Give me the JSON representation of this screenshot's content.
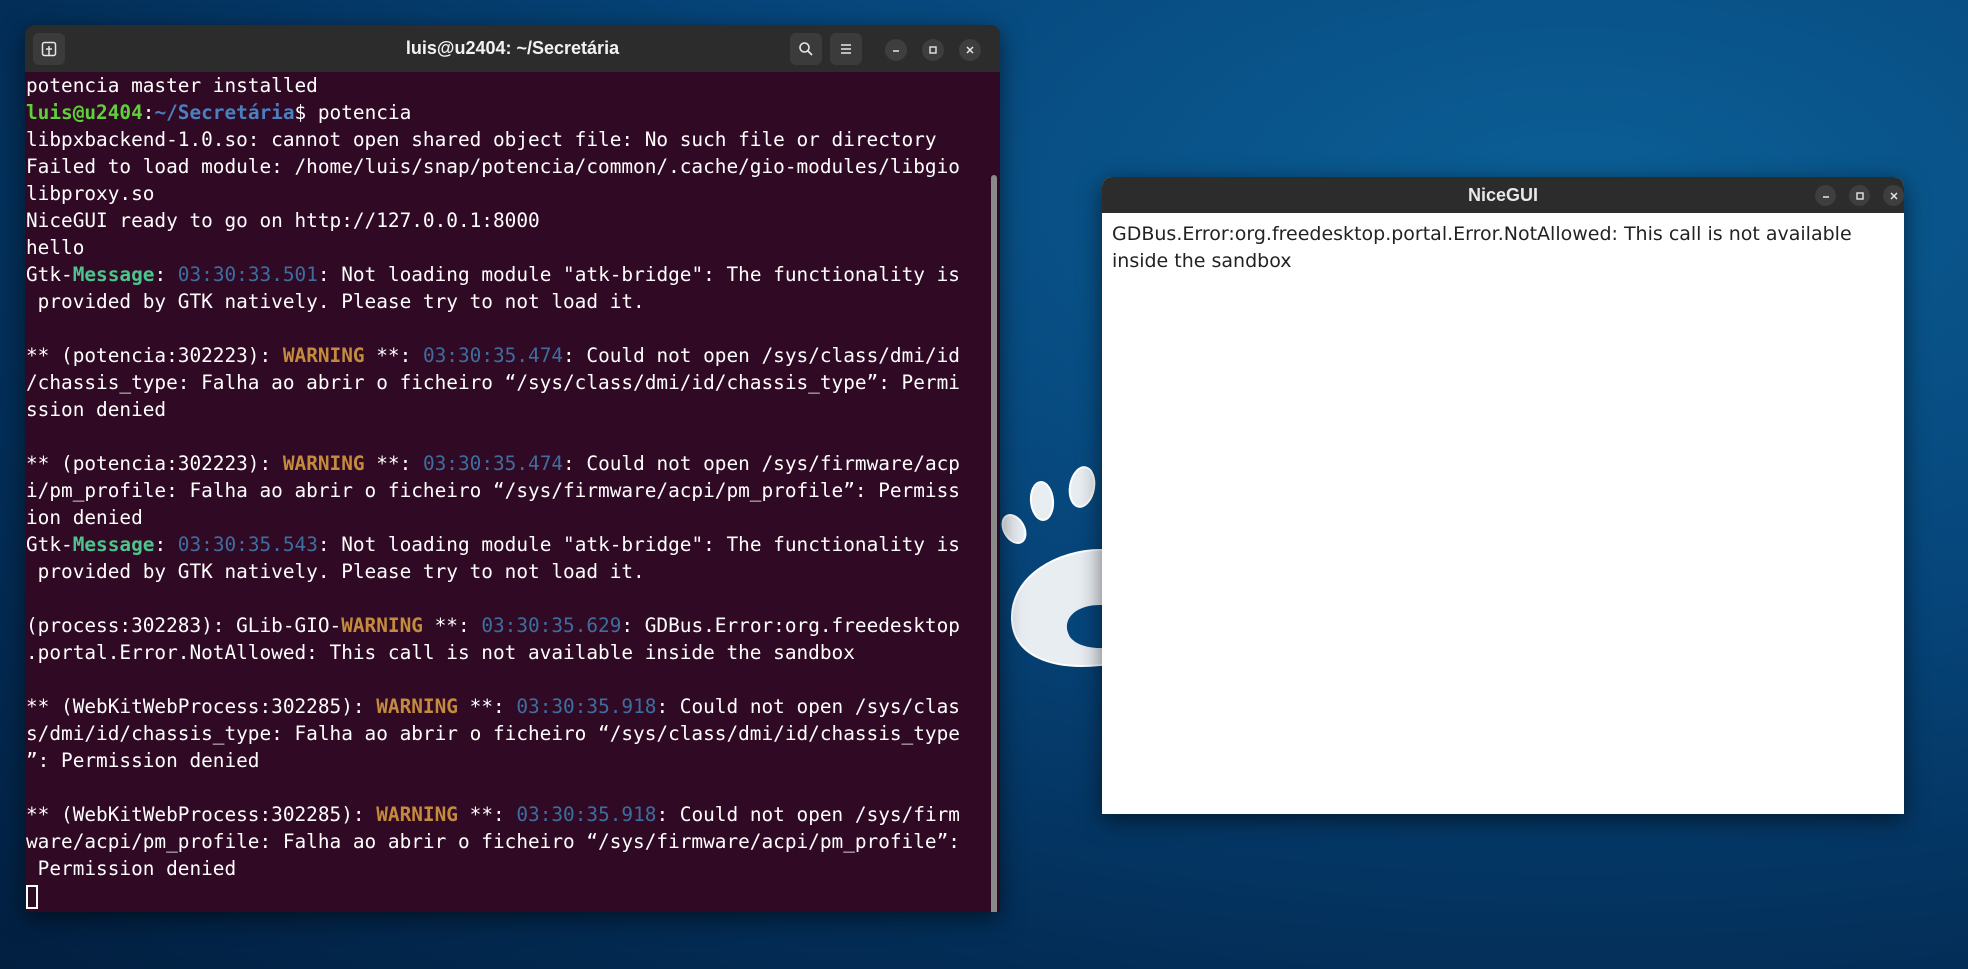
{
  "terminal": {
    "title": "luis@u2404: ~/Secretária",
    "prompt_user": "luis@u2404",
    "prompt_path": "~/Secretária",
    "command": "potencia"
  },
  "nicegui": {
    "title": "NiceGUI",
    "message": "GDBus.Error:org.freedesktop.portal.Error.NotAllowed: This call is not available inside the sandbox"
  },
  "colors": {
    "terminal_bg": "#300a24",
    "titlebar_bg": "#2c2c2c",
    "prompt_user": "#5ed13a",
    "prompt_path": "#4a7fc0",
    "warning": "#c48b3e",
    "message": "#4cc48c",
    "timestamp": "#3d6ea0"
  },
  "icons": {
    "new_tab": "new-tab-icon",
    "search": "search-icon",
    "menu": "hamburger-menu-icon",
    "minimize": "minimize-icon",
    "maximize": "maximize-icon",
    "close": "close-icon"
  },
  "lines": [
    [
      {
        "t": "potencia master installed"
      }
    ],
    [
      {
        "t": "luis@u2404",
        "c": "u"
      },
      {
        "t": ":"
      },
      {
        "t": "~/Secretária",
        "c": "p"
      },
      {
        "t": "$ potencia"
      }
    ],
    [
      {
        "t": "libpxbackend-1.0.so: cannot open shared object file: No such file or directory"
      }
    ],
    [
      {
        "t": "Failed to load module: /home/luis/snap/potencia/common/.cache/gio-modules/libgio"
      }
    ],
    [
      {
        "t": "libproxy.so"
      }
    ],
    [
      {
        "t": "NiceGUI ready to go on http://127.0.0.1:8000"
      }
    ],
    [
      {
        "t": "hello"
      }
    ],
    [
      {
        "t": "Gtk-"
      },
      {
        "t": "Message",
        "c": "g"
      },
      {
        "t": ": "
      },
      {
        "t": "03:30:33.501",
        "c": "ts"
      },
      {
        "t": ": Not loading module \"atk-bridge\": The functionality is"
      }
    ],
    [
      {
        "t": " provided by GTK natively. Please try to not load it."
      }
    ],
    [],
    [
      {
        "t": "** (potencia:302223): "
      },
      {
        "t": "WARNING",
        "c": "w"
      },
      {
        "t": " **: "
      },
      {
        "t": "03:30:35.474",
        "c": "ts"
      },
      {
        "t": ": Could not open /sys/class/dmi/id"
      }
    ],
    [
      {
        "t": "/chassis_type: Falha ao abrir o ficheiro “/sys/class/dmi/id/chassis_type”: Permi"
      }
    ],
    [
      {
        "t": "ssion denied"
      }
    ],
    [],
    [
      {
        "t": "** (potencia:302223): "
      },
      {
        "t": "WARNING",
        "c": "w"
      },
      {
        "t": " **: "
      },
      {
        "t": "03:30:35.474",
        "c": "ts"
      },
      {
        "t": ": Could not open /sys/firmware/acp"
      }
    ],
    [
      {
        "t": "i/pm_profile: Falha ao abrir o ficheiro “/sys/firmware/acpi/pm_profile”: Permiss"
      }
    ],
    [
      {
        "t": "ion denied"
      }
    ],
    [
      {
        "t": "Gtk-"
      },
      {
        "t": "Message",
        "c": "g"
      },
      {
        "t": ": "
      },
      {
        "t": "03:30:35.543",
        "c": "ts"
      },
      {
        "t": ": Not loading module \"atk-bridge\": The functionality is"
      }
    ],
    [
      {
        "t": " provided by GTK natively. Please try to not load it."
      }
    ],
    [],
    [
      {
        "t": "(process:302283): GLib-GIO-"
      },
      {
        "t": "WARNING",
        "c": "w"
      },
      {
        "t": " **: "
      },
      {
        "t": "03:30:35.629",
        "c": "ts"
      },
      {
        "t": ": GDBus.Error:org.freedesktop"
      }
    ],
    [
      {
        "t": ".portal.Error.NotAllowed: This call is not available inside the sandbox"
      }
    ],
    [],
    [
      {
        "t": "** (WebKitWebProcess:302285): "
      },
      {
        "t": "WARNING",
        "c": "w"
      },
      {
        "t": " **: "
      },
      {
        "t": "03:30:35.918",
        "c": "ts"
      },
      {
        "t": ": Could not open /sys/clas"
      }
    ],
    [
      {
        "t": "s/dmi/id/chassis_type: Falha ao abrir o ficheiro “/sys/class/dmi/id/chassis_type"
      }
    ],
    [
      {
        "t": "”: Permission denied"
      }
    ],
    [],
    [
      {
        "t": "** (WebKitWebProcess:302285): "
      },
      {
        "t": "WARNING",
        "c": "w"
      },
      {
        "t": " **: "
      },
      {
        "t": "03:30:35.918",
        "c": "ts"
      },
      {
        "t": ": Could not open /sys/firm"
      }
    ],
    [
      {
        "t": "ware/acpi/pm_profile: Falha ao abrir o ficheiro “/sys/firmware/acpi/pm_profile”:"
      }
    ],
    [
      {
        "t": " Permission denied"
      }
    ]
  ]
}
